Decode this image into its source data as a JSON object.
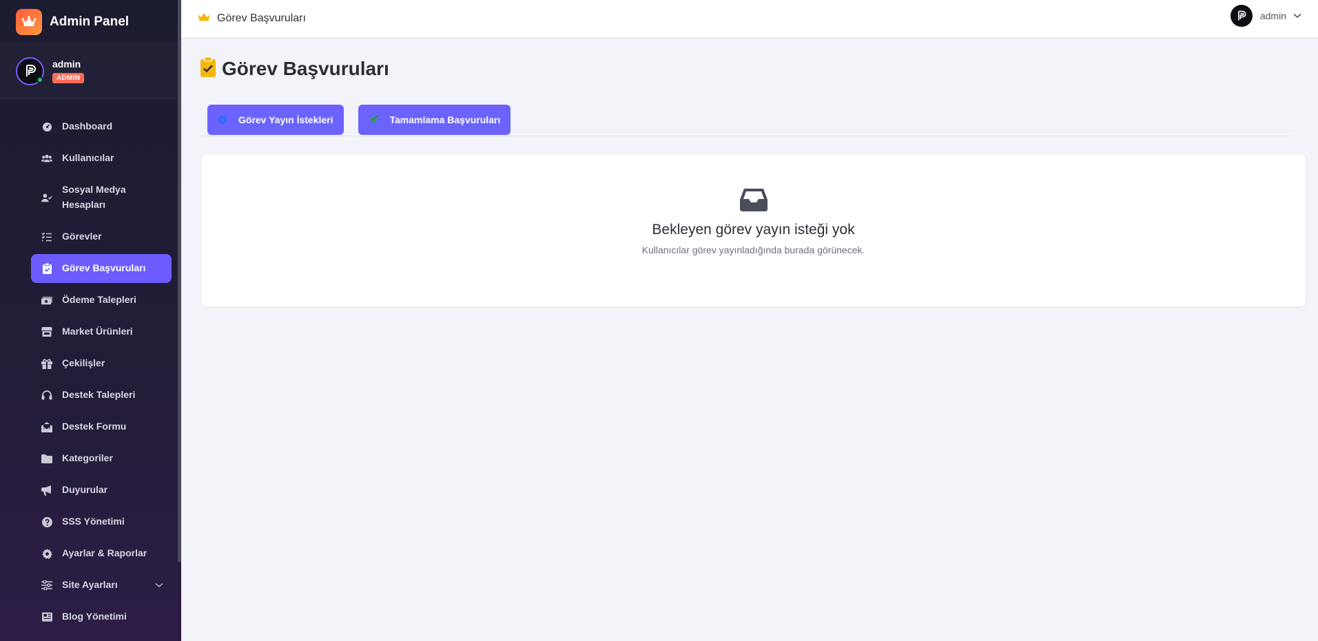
{
  "brand": {
    "title": "Admin Panel"
  },
  "user": {
    "name": "admin",
    "role": "ADMIN"
  },
  "sidebar": {
    "items": [
      {
        "label": "Dashboard"
      },
      {
        "label": "Kullanıcılar"
      },
      {
        "label": "Sosyal Medya Hesapları"
      },
      {
        "label": "Görevler"
      },
      {
        "label": "Görev Başvuruları",
        "active": true
      },
      {
        "label": "Ödeme Talepleri"
      },
      {
        "label": "Market Ürünleri"
      },
      {
        "label": "Çekilişler"
      },
      {
        "label": "Destek Talepleri"
      },
      {
        "label": "Destek Formu"
      },
      {
        "label": "Kategoriler"
      },
      {
        "label": "Duyurular"
      },
      {
        "label": "SSS Yönetimi"
      },
      {
        "label": "Ayarlar & Raporlar"
      },
      {
        "label": "Site Ayarları"
      },
      {
        "label": "Blog Yönetimi"
      }
    ]
  },
  "topbar": {
    "breadcrumb": "Görev Başvuruları",
    "user_name": "admin"
  },
  "main": {
    "title": "Görev Başvuruları",
    "tabs": [
      {
        "label": "Görev Yayın İstekleri"
      },
      {
        "label": "Tamamlama Başvuruları"
      }
    ],
    "empty": {
      "title": "Bekleyen görev yayın isteği yok",
      "subtitle": "Kullanıcılar görev yayınladığında burada görünecek."
    }
  },
  "colors": {
    "accent": "#6c5cff",
    "tab": "#6c63ff",
    "brand_gradient_start": "#ff5b3d",
    "badge": "#ff6b57",
    "crown": "#f5b50a",
    "online": "#22c55e"
  },
  "icons": {
    "brand": "crown-icon",
    "nav": [
      "dashboard-icon",
      "users-icon",
      "user-check-icon",
      "list-check-icon",
      "clipboard-check-icon",
      "money-icon",
      "store-icon",
      "gift-icon",
      "headset-icon",
      "envelope-open-icon",
      "folder-icon",
      "megaphone-icon",
      "question-circle-icon",
      "gear-icon",
      "sliders-icon",
      "newspaper-icon"
    ],
    "empty": "inbox-icon"
  }
}
